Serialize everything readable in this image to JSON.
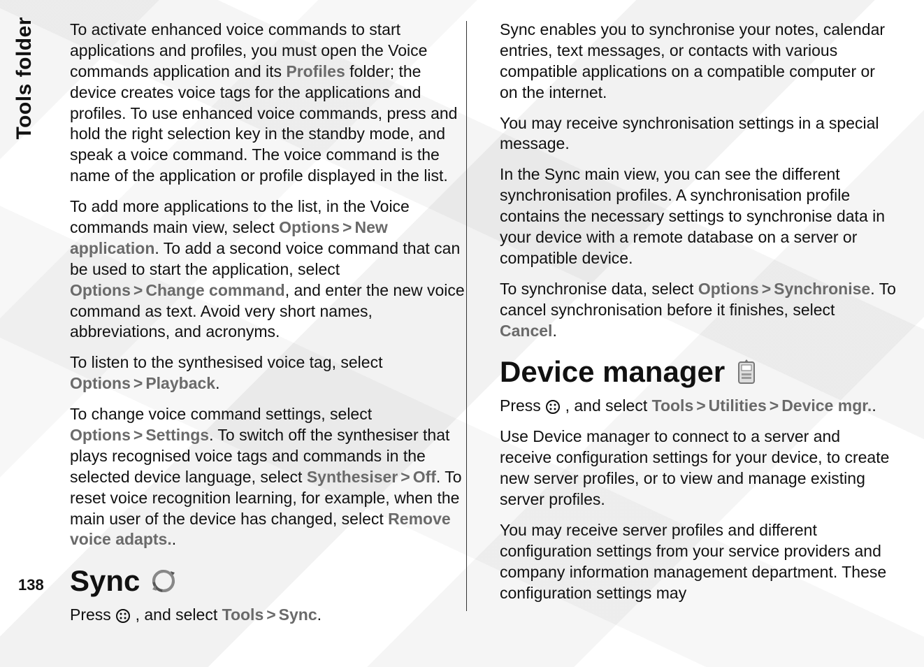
{
  "sidebar": {
    "title": "Tools folder"
  },
  "page_number": "138",
  "left": {
    "p1": {
      "a": "To activate enhanced voice commands to start applications and profiles, you must open the Voice commands application and its ",
      "profiles": "Profiles",
      "b": " folder; the device creates voice tags for the applications and profiles. To use enhanced voice commands, press and hold the right selection key in the standby mode, and speak a voice command. The voice command is the name of the application or profile displayed in the list."
    },
    "p2": {
      "a": "To add more applications to the list, in the Voice commands main view, select ",
      "options": "Options",
      "newapp": "New application",
      "b": ". To add a second voice command that can be used to start the application, select ",
      "options2": "Options",
      "changecmd": "Change command",
      "c": ", and enter the new voice command as text. Avoid very short names, abbreviations, and acronyms."
    },
    "p3": {
      "a": "To listen to the synthesised voice tag, select ",
      "options": "Options",
      "playback": "Playback",
      "b": "."
    },
    "p4": {
      "a": "To change voice command settings, select ",
      "options": "Options",
      "settings": "Settings",
      "b": ". To switch off the synthesiser that plays recognised voice tags and commands in the selected device language, select ",
      "synth": "Synthesiser",
      "off": "Off",
      "c": ". To reset voice recognition learning, for example, when the main user of the device has changed, select ",
      "rva": "Remove voice adapts.",
      "d": "."
    },
    "sync_heading": "Sync",
    "p5": {
      "a": "Press ",
      "b": " , and select ",
      "tools": "Tools",
      "sync": "Sync",
      "c": "."
    }
  },
  "right": {
    "p1": "Sync enables you to synchronise your notes, calendar entries, text messages, or contacts with various compatible applications on a compatible computer or on the internet.",
    "p2": "You may receive synchronisation settings in a special message.",
    "p3": "In the Sync main view, you can see the different synchronisation profiles. A synchronisation profile contains the necessary settings to synchronise data in your device with a remote database on a server or compatible device.",
    "p4": {
      "a": "To synchronise data, select ",
      "options": "Options",
      "sync": "Synchronise",
      "b": ". To cancel synchronisation before it finishes, select ",
      "cancel": "Cancel",
      "c": "."
    },
    "devmgr_heading": "Device manager",
    "p5": {
      "a": "Press ",
      "b": " , and select ",
      "tools": "Tools",
      "util": "Utilities",
      "devmgr": "Device mgr.",
      "c": "."
    },
    "p6": "Use Device manager to connect to a server and receive configuration settings for your device, to create new server profiles, or to view and manage existing server profiles.",
    "p7": "You may receive server profiles and different configuration settings from your service providers and company information management department. These configuration settings may"
  },
  "separators": {
    "gt": ">"
  }
}
